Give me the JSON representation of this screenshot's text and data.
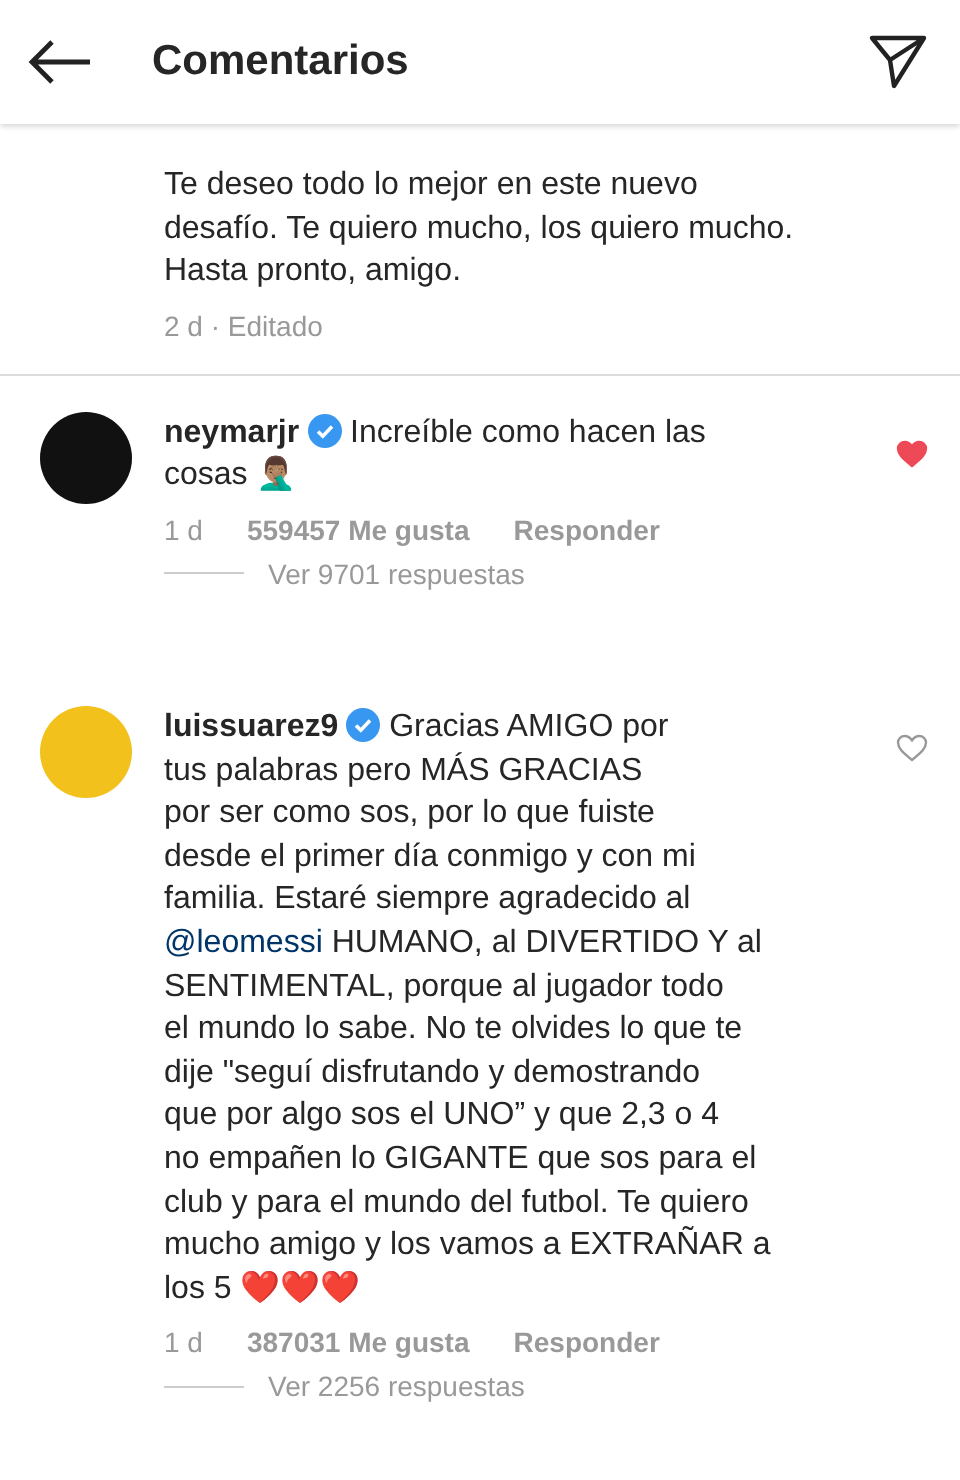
{
  "header": {
    "title": "Comentarios"
  },
  "caption_tail": {
    "text": "Te deseo todo lo mejor en este nuevo\ndesafío. Te quiero mucho, los quiero mucho.\nHasta pronto, amigo.",
    "meta": "2 d · Editado"
  },
  "comments": [
    {
      "username": "neymarjr",
      "verified": true,
      "parts": [
        {
          "kind": "text",
          "text": "Increíble como hacen las\ncosas 🤦🏽‍♂️"
        }
      ],
      "time": "1 d",
      "likes": "559457 Me gusta",
      "reply": "Responder",
      "liked": true,
      "replies": "Ver 9701 respuestas",
      "color": "#111111"
    },
    {
      "username": "luissuarez9",
      "verified": true,
      "parts": [
        {
          "kind": "text",
          "text": "Gracias AMIGO por\ntus palabras pero MÁS GRACIAS\npor ser como sos, por lo que fuiste\ndesde el primer día conmigo y con mi\nfamilia. Estaré siempre agradecido al\n"
        },
        {
          "kind": "mention",
          "text": "@leomessi"
        },
        {
          "kind": "text",
          "text": " HUMANO, al DIVERTIDO Y al\nSENTIMENTAL, porque al jugador todo\nel mundo lo sabe. No te olvides lo que te\ndije \"seguí disfrutando y demostrando\nque por algo sos el UNO” y que 2,3 o 4\nno empañen lo GIGANTE que sos para el\nclub y para el mundo del futbol. Te quiero\nmucho amigo y los vamos a EXTRAÑAR a\nlos 5 ❤️❤️❤️"
        }
      ],
      "time": "1 d",
      "likes": "387031 Me gusta",
      "reply": "Responder",
      "liked": false,
      "replies": "Ver 2256 respuestas",
      "color": "#f3c11c"
    }
  ]
}
